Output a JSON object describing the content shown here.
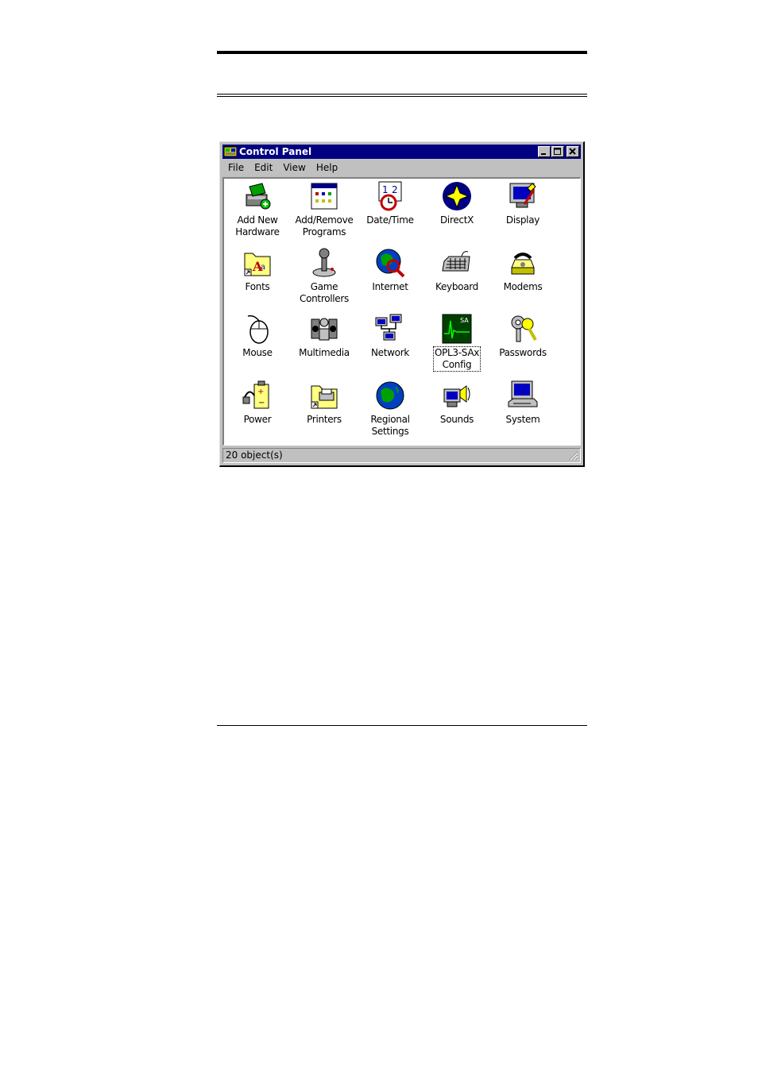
{
  "window": {
    "title": "Control Panel",
    "titlebar_color": "#000080",
    "buttons": [
      "minimize-icon",
      "maximize-icon",
      "close-icon"
    ]
  },
  "menu": [
    {
      "label": "File"
    },
    {
      "label": "Edit"
    },
    {
      "label": "View"
    },
    {
      "label": "Help"
    }
  ],
  "items": [
    {
      "line1": "Add New",
      "line2": "Hardware",
      "icon": "add-hardware-icon"
    },
    {
      "line1": "Add/Remove",
      "line2": "Programs",
      "icon": "add-remove-programs-icon"
    },
    {
      "line1": "Date/Time",
      "line2": "",
      "icon": "date-time-icon"
    },
    {
      "line1": "DirectX",
      "line2": "",
      "icon": "directx-icon"
    },
    {
      "line1": "Display",
      "line2": "",
      "icon": "display-icon"
    },
    {
      "line1": "Fonts",
      "line2": "",
      "icon": "fonts-icon"
    },
    {
      "line1": "Game",
      "line2": "Controllers",
      "icon": "game-controllers-icon"
    },
    {
      "line1": "Internet",
      "line2": "",
      "icon": "internet-icon"
    },
    {
      "line1": "Keyboard",
      "line2": "",
      "icon": "keyboard-icon"
    },
    {
      "line1": "Modems",
      "line2": "",
      "icon": "modems-icon"
    },
    {
      "line1": "Mouse",
      "line2": "",
      "icon": "mouse-icon"
    },
    {
      "line1": "Multimedia",
      "line2": "",
      "icon": "multimedia-icon"
    },
    {
      "line1": "Network",
      "line2": "",
      "icon": "network-icon"
    },
    {
      "line1": "OPL3-SAx",
      "line2": "Config",
      "icon": "opl3-sax-config-icon",
      "selected": true
    },
    {
      "line1": "Passwords",
      "line2": "",
      "icon": "passwords-icon"
    },
    {
      "line1": "Power",
      "line2": "",
      "icon": "power-icon"
    },
    {
      "line1": "Printers",
      "line2": "",
      "icon": "printers-icon"
    },
    {
      "line1": "Regional",
      "line2": "Settings",
      "icon": "regional-settings-icon"
    },
    {
      "line1": "Sounds",
      "line2": "",
      "icon": "sounds-icon"
    },
    {
      "line1": "System",
      "line2": "",
      "icon": "system-icon"
    }
  ],
  "opl_badge": "SA",
  "status": {
    "text": "20 object(s)"
  }
}
